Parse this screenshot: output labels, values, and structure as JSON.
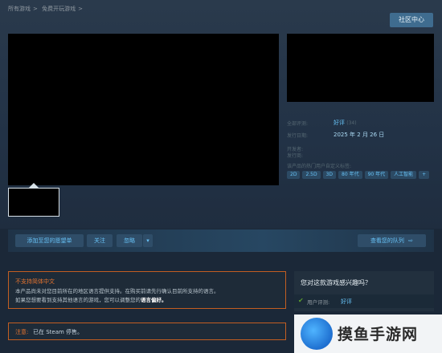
{
  "breadcrumb": [
    "所有游戏",
    "免费开玩游戏"
  ],
  "header": {
    "community_label": "社区中心"
  },
  "info": {
    "reviews_label": "全部评测:",
    "reviews_value": "好评",
    "reviews_count": "(34)",
    "release_label": "发行日期:",
    "release_value": "2025 年 2 月 26 日",
    "developer_label": "开发者:",
    "publisher_label": "发行商:",
    "tags_label": "该产品的热门用户自定义标签:"
  },
  "tags": [
    "2D",
    "2.5D",
    "3D",
    "80 年代",
    "90 年代",
    "人工智能",
    "+"
  ],
  "actions": {
    "wishlist": "添加至您的愿望单",
    "follow": "关注",
    "ignore": "忽略",
    "queue": "查看您的队列"
  },
  "notice": {
    "title": "不支持简体中文",
    "line1": "本产品尚未对您目前所在的地区语言提供支持。在购买前请先行确认目前所支持的语言。",
    "line2_prefix": "如果您想要看到支持其他语言的游戏，您可以调整您的",
    "line2_link": "语言偏好。"
  },
  "note": {
    "label": "注意:",
    "text": "已在 Steam 停售。"
  },
  "interest": {
    "title": "您对这款游戏感兴趣吗？",
    "row_label": "用户评测:",
    "row_value": "好评"
  },
  "watermark": {
    "text": "摸鱼手游网"
  },
  "colors": {
    "accent": "#66c0f4",
    "warning": "#c35e21",
    "bg": "#1b2838"
  }
}
